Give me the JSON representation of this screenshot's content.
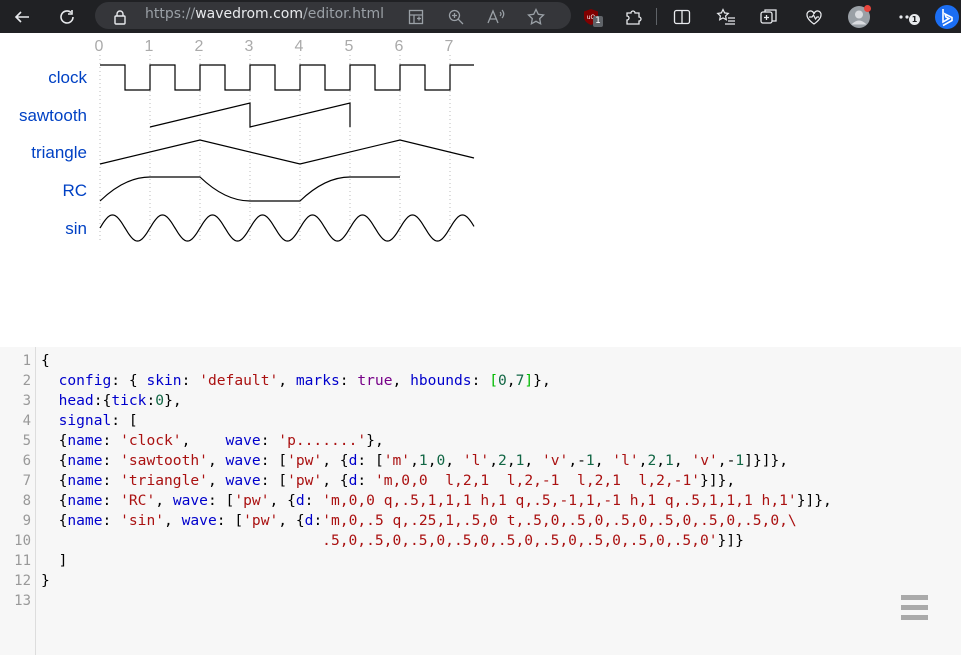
{
  "browser": {
    "url_scheme": "https://",
    "url_host": "wavedrom.com",
    "url_path": "/editor.html",
    "extension_badge": "1",
    "profile_badge": "1"
  },
  "diagram": {
    "ticks": [
      "0",
      "1",
      "2",
      "3",
      "4",
      "5",
      "6",
      "7"
    ],
    "signals": [
      "clock",
      "sawtooth",
      "triangle",
      "RC",
      "sin"
    ]
  },
  "editor": {
    "line_numbers": [
      "1",
      "2",
      "3",
      "4",
      "5",
      "6",
      "7",
      "8",
      "9",
      "10",
      "11",
      "12",
      "13"
    ],
    "lines": [
      [
        [
          "p",
          "{"
        ]
      ],
      [
        [
          "p",
          "  "
        ],
        [
          "prop",
          "config"
        ],
        [
          "p",
          ": { "
        ],
        [
          "prop",
          "skin"
        ],
        [
          "p",
          ": "
        ],
        [
          "str",
          "'default'"
        ],
        [
          "p",
          ", "
        ],
        [
          "prop",
          "marks"
        ],
        [
          "p",
          ": "
        ],
        [
          "kw",
          "true"
        ],
        [
          "p",
          ", "
        ],
        [
          "prop",
          "hbounds"
        ],
        [
          "p",
          ": "
        ],
        [
          "br",
          "["
        ],
        [
          "num",
          "0"
        ],
        [
          "p",
          ","
        ],
        [
          "num",
          "7"
        ],
        [
          "br",
          "]"
        ],
        [
          "p",
          "},"
        ]
      ],
      [
        [
          "p",
          "  "
        ],
        [
          "prop",
          "head"
        ],
        [
          "p",
          ":{"
        ],
        [
          "prop",
          "tick"
        ],
        [
          "p",
          ":"
        ],
        [
          "num",
          "0"
        ],
        [
          "p",
          "},"
        ]
      ],
      [
        [
          "p",
          "  "
        ],
        [
          "prop",
          "signal"
        ],
        [
          "p",
          ": ["
        ]
      ],
      [
        [
          "p",
          "  {"
        ],
        [
          "prop",
          "name"
        ],
        [
          "p",
          ": "
        ],
        [
          "str",
          "'clock'"
        ],
        [
          "p",
          ",    "
        ],
        [
          "prop",
          "wave"
        ],
        [
          "p",
          ": "
        ],
        [
          "str",
          "'p.......'"
        ],
        [
          "p",
          "},"
        ]
      ],
      [
        [
          "p",
          "  {"
        ],
        [
          "prop",
          "name"
        ],
        [
          "p",
          ": "
        ],
        [
          "str",
          "'sawtooth'"
        ],
        [
          "p",
          ", "
        ],
        [
          "prop",
          "wave"
        ],
        [
          "p",
          ": ["
        ],
        [
          "str",
          "'pw'"
        ],
        [
          "p",
          ", {"
        ],
        [
          "prop",
          "d"
        ],
        [
          "p",
          ": ["
        ],
        [
          "str",
          "'m'"
        ],
        [
          "p",
          ","
        ],
        [
          "num",
          "1"
        ],
        [
          "p",
          ","
        ],
        [
          "num",
          "0"
        ],
        [
          "p",
          ", "
        ],
        [
          "str",
          "'l'"
        ],
        [
          "p",
          ","
        ],
        [
          "num",
          "2"
        ],
        [
          "p",
          ","
        ],
        [
          "num",
          "1"
        ],
        [
          "p",
          ", "
        ],
        [
          "str",
          "'v'"
        ],
        [
          "p",
          ",-"
        ],
        [
          "num",
          "1"
        ],
        [
          "p",
          ", "
        ],
        [
          "str",
          "'l'"
        ],
        [
          "p",
          ","
        ],
        [
          "num",
          "2"
        ],
        [
          "p",
          ","
        ],
        [
          "num",
          "1"
        ],
        [
          "p",
          ", "
        ],
        [
          "str",
          "'v'"
        ],
        [
          "p",
          ",-"
        ],
        [
          "num",
          "1"
        ],
        [
          "p",
          "]}]},"
        ]
      ],
      [
        [
          "p",
          "  {"
        ],
        [
          "prop",
          "name"
        ],
        [
          "p",
          ": "
        ],
        [
          "str",
          "'triangle'"
        ],
        [
          "p",
          ", "
        ],
        [
          "prop",
          "wave"
        ],
        [
          "p",
          ": ["
        ],
        [
          "str",
          "'pw'"
        ],
        [
          "p",
          ", {"
        ],
        [
          "prop",
          "d"
        ],
        [
          "p",
          ": "
        ],
        [
          "str",
          "'m,0,0  l,2,1  l,2,-1  l,2,1  l,2,-1'"
        ],
        [
          "p",
          "}]},"
        ]
      ],
      [
        [
          "p",
          "  {"
        ],
        [
          "prop",
          "name"
        ],
        [
          "p",
          ": "
        ],
        [
          "str",
          "'RC'"
        ],
        [
          "p",
          ", "
        ],
        [
          "prop",
          "wave"
        ],
        [
          "p",
          ": ["
        ],
        [
          "str",
          "'pw'"
        ],
        [
          "p",
          ", {"
        ],
        [
          "prop",
          "d"
        ],
        [
          "p",
          ": "
        ],
        [
          "str",
          "'m,0,0 q,.5,1,1,1 h,1 q,.5,-1,1,-1 h,1 q,.5,1,1,1 h,1'"
        ],
        [
          "p",
          "}]},"
        ]
      ],
      [
        [
          "p",
          "  {"
        ],
        [
          "prop",
          "name"
        ],
        [
          "p",
          ": "
        ],
        [
          "str",
          "'sin'"
        ],
        [
          "p",
          ", "
        ],
        [
          "prop",
          "wave"
        ],
        [
          "p",
          ": ["
        ],
        [
          "str",
          "'pw'"
        ],
        [
          "p",
          ", {"
        ],
        [
          "prop",
          "d"
        ],
        [
          "p",
          ":"
        ],
        [
          "str",
          "'m,0,.5 q,.25,1,.5,0 t,.5,0,.5,0,.5,0,.5,0,.5,0,.5,0,\\"
        ]
      ],
      [
        [
          "str",
          "                                .5,0,.5,0,.5,0,.5,0,.5,0,.5,0,.5,0,.5,0,.5,0'"
        ],
        [
          "p",
          "}]}"
        ]
      ],
      [
        [
          "p",
          "  ]"
        ]
      ],
      [
        [
          "p",
          "}"
        ]
      ],
      []
    ]
  }
}
